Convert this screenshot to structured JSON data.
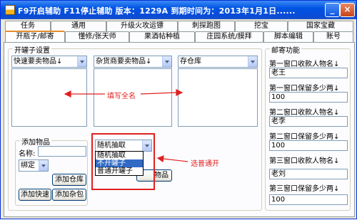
{
  "window": {
    "title": "F9开启辅助   F11停止辅助  版本：1229A   到期时间为：2013年1月1日......",
    "minimize_label": "_",
    "close_label": "×"
  },
  "tabs": [
    {
      "label": "任务"
    },
    {
      "label": "通用"
    },
    {
      "label": "升级火攻运镖"
    },
    {
      "label": "刺探跑图"
    },
    {
      "label": "挖宝"
    },
    {
      "label": "国家宝藏"
    },
    {
      "label": "开瓶子/邮寄"
    },
    {
      "label": "懂修/张天师"
    },
    {
      "label": "果酒帖种植"
    },
    {
      "label": "庄园系统/膜拜"
    },
    {
      "label": "脚本编辑"
    },
    {
      "label": "账号"
    }
  ],
  "jar_settings": {
    "group_label": "开罐子设置",
    "combo1": "快速要卖物品↓",
    "combo2": "杂货商要卖物品↓",
    "combo3": "存仓库",
    "fill_name_annotation": "填写全名",
    "select_annotation": "选普通开"
  },
  "add_item": {
    "group_label": "添加物品",
    "name_label": "名称:",
    "name_value": "",
    "bind_value": "绑定",
    "jar_mode_value": "随机抽取",
    "dropdown_options": [
      "随机抽取",
      "不开罐子",
      "普通开罐子"
    ],
    "dropdown_selected_index": 1,
    "add_warehouse_label": "添加仓库",
    "add_quick_label": "添加快速",
    "add_grocery_label": "添加杂包",
    "hidden_button_label": "物品"
  },
  "mail": {
    "group_label": "邮寄功能",
    "recipient_label_1": "第一窗口收款人物名↓",
    "recipient_value_1": "老王",
    "keep_label_1": "第一窗口保留多少两↓",
    "keep_value_1": "100",
    "recipient_label_2": "第二窗口收款人物名↓",
    "recipient_value_2": "老李",
    "keep_label_2": "第二窗口保留多少两↓",
    "keep_value_2": "100",
    "recipient_label_3": "第三窗口收款人物名↓",
    "recipient_value_3": "老刘",
    "keep_label_3": "第三窗口保留多少两↓",
    "keep_value_3": "100"
  },
  "colors": {
    "annotation": "#e02020",
    "titlebar": "#0054e3",
    "selection": "#316ac5"
  }
}
